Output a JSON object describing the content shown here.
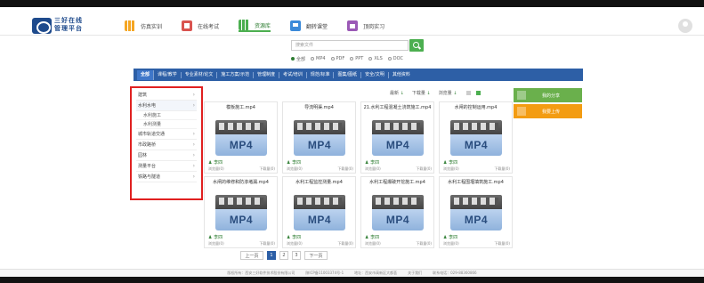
{
  "header": {
    "logo_line1": "三好在线",
    "logo_line2": "管理平台",
    "nav": [
      {
        "label": "仿真实训",
        "icon": "bar-chart-icon"
      },
      {
        "label": "在线考试",
        "icon": "exam-icon"
      },
      {
        "label": "资源库",
        "icon": "library-icon",
        "active": true
      },
      {
        "label": "翻转课堂",
        "icon": "classroom-icon"
      },
      {
        "label": "顶岗实习",
        "icon": "internship-icon"
      }
    ]
  },
  "search": {
    "placeholder": "搜索文件",
    "filetypes": [
      {
        "label": "全部",
        "selected": true
      },
      {
        "label": "MP4",
        "selected": false
      },
      {
        "label": "PDF",
        "selected": false
      },
      {
        "label": "PPT",
        "selected": false
      },
      {
        "label": "XLS",
        "selected": false
      },
      {
        "label": "DOC",
        "selected": false
      }
    ]
  },
  "categories": [
    "全部",
    "课程/教学",
    "专业素材/论文",
    "施工方案/示范",
    "管理制度",
    "考试/培训",
    "规范/标准",
    "图集/图纸",
    "安全/文明",
    "其他资料"
  ],
  "sidebar": {
    "items": [
      {
        "label": "建筑",
        "chev": "›"
      },
      {
        "label": "水利水电",
        "chev": "›",
        "expanded": true
      },
      {
        "label": "城市轨道交通",
        "chev": "›"
      },
      {
        "label": "市政路桥",
        "chev": "›"
      },
      {
        "label": "园林",
        "chev": "›"
      },
      {
        "label": "测量平台",
        "chev": "›"
      },
      {
        "label": "铁路与隧道",
        "chev": "›"
      }
    ],
    "subitems": [
      "水利施工",
      "水利测量"
    ]
  },
  "sort": {
    "latest": "最新",
    "downloads": "下载量",
    "views": "浏览量",
    "arrow": "↓"
  },
  "actions": {
    "share": "我的分享",
    "upload": "我要上传"
  },
  "cards": [
    {
      "title": "模板施工.mp4",
      "author": "李四",
      "views": "浏览量(0)",
      "downloads": "下载量(0)"
    },
    {
      "title": "导流明渠.mp4",
      "author": "李四",
      "views": "浏览量(0)",
      "downloads": "下载量(0)"
    },
    {
      "title": "21.水利工程混凝土浇筑施工.mp4",
      "author": "李四",
      "views": "浏览量(0)",
      "downloads": "下载量(0)"
    },
    {
      "title": "水闸的控制运用.mp4",
      "author": "李四",
      "views": "浏览量(0)",
      "downloads": "下载量(0)"
    },
    {
      "title": "水闸的维修和防渗堵漏.mp4",
      "author": "李四",
      "views": "浏览量(0)",
      "downloads": "下载量(0)"
    },
    {
      "title": "水利工程监控测量.mp4",
      "author": "李四",
      "views": "浏览量(0)",
      "downloads": "下载量(0)"
    },
    {
      "title": "水利工程爆破开挖施工.mp4",
      "author": "李四",
      "views": "浏览量(0)",
      "downloads": "下载量(0)"
    },
    {
      "title": "水利工程围堰填筑施工.mp4",
      "author": "李四",
      "views": "浏览量(0)",
      "downloads": "下载量(0)"
    }
  ],
  "thumb_text": "MP4",
  "pagination": {
    "prev": "上一页",
    "pages": [
      "1",
      "2",
      "3"
    ],
    "current": "1",
    "next": "下一页"
  },
  "footer": {
    "copyright": "版权所有：西安三好软件技术股份有限公司",
    "icp": "陕ICP备11003374号-1",
    "address": "地址：西安市高新区大都荟",
    "about": "关于我们",
    "phone": "联系电话：029-88360866"
  },
  "colors": {
    "brand_blue": "#2d5fa6",
    "accent_green": "#4caf50",
    "share_green": "#6ab04c",
    "upload_orange": "#f39c12",
    "highlight_red": "#e02020"
  }
}
